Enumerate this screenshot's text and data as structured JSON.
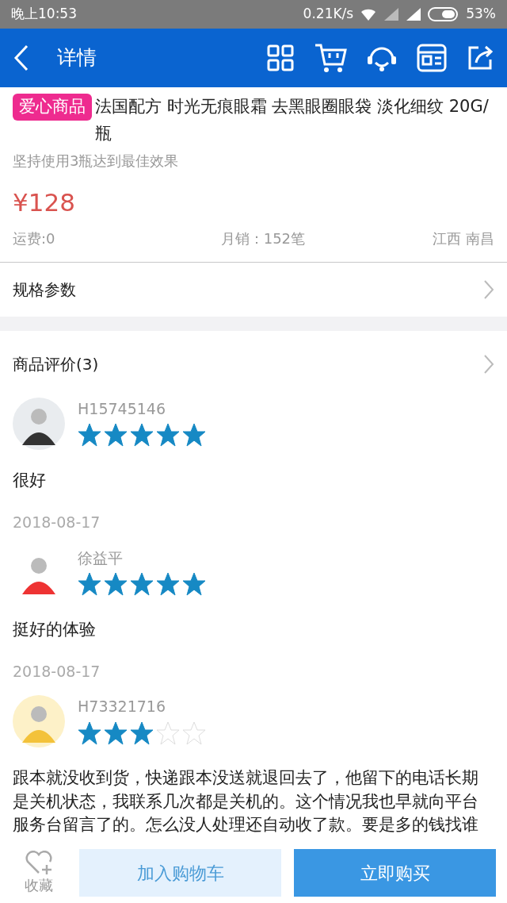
{
  "status_bar": {
    "time": "晚上10:53",
    "speed": "0.21K/s",
    "battery": "53%"
  },
  "header": {
    "title": "详情"
  },
  "product": {
    "tag": "爱心商品",
    "title": "法国配方 时光无痕眼霜 去黑眼圈眼袋 淡化细纹 20G/瓶",
    "subtitle": "坚持使用3瓶达到最佳效果",
    "price": "¥128",
    "shipping": "运费:0",
    "monthly_sales": "月销：152笔",
    "location": "江西 南昌"
  },
  "specs": {
    "label": "规格参数"
  },
  "reviews": {
    "title": "商品评价(3)",
    "items": [
      {
        "user": "H15745146",
        "stars": 5,
        "text": "很好",
        "date": "2018-08-17"
      },
      {
        "user": "徐益平",
        "stars": 5,
        "text": "挺好的体验",
        "date": "2018-08-17"
      },
      {
        "user": "H73321716",
        "stars": 3,
        "text": "跟本就没收到货，快递跟本没送就退回去了，他留下的电话长期是关机状态，我联系几次都是关机的。这个情况我也早就向平台服务台留言了的。怎么没人处理还自动收了款。要是多的钱找谁"
      }
    ]
  },
  "bottom_bar": {
    "favorite": "收藏",
    "add_to_cart": "加入购物车",
    "buy_now": "立即购买"
  }
}
